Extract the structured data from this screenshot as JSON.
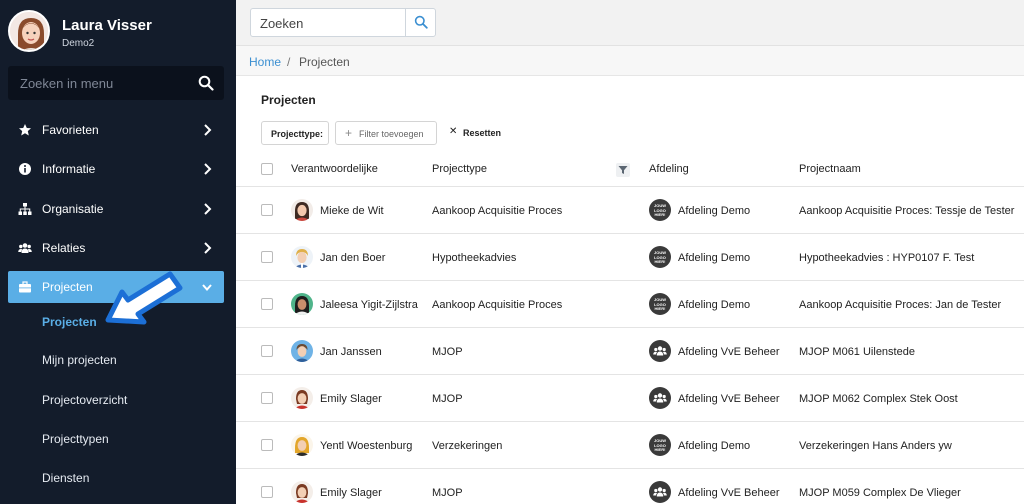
{
  "profile": {
    "name": "Laura Visser",
    "subtitle": "Demo2"
  },
  "menu_search": {
    "placeholder": "Zoeken in menu"
  },
  "menu": [
    {
      "label": "Favorieten",
      "icon": "star-icon"
    },
    {
      "label": "Informatie",
      "icon": "info-icon"
    },
    {
      "label": "Organisatie",
      "icon": "sitemap-icon"
    },
    {
      "label": "Relaties",
      "icon": "users-icon"
    },
    {
      "label": "Projecten",
      "icon": "briefcase-icon",
      "active": true
    }
  ],
  "submenu": [
    {
      "label": "Projecten",
      "active": true
    },
    {
      "label": "Mijn projecten"
    },
    {
      "label": "Projectoverzicht"
    },
    {
      "label": "Projecttypen"
    },
    {
      "label": "Diensten"
    }
  ],
  "top_search": {
    "placeholder": "Zoeken"
  },
  "breadcrumb": {
    "home": "Home",
    "separator": "/",
    "current": "Projecten"
  },
  "section_title": "Projecten",
  "filters": {
    "type_label": "Projecttype:",
    "add_label": "Filter toevoegen",
    "reset_label": "Resetten"
  },
  "table": {
    "headers": {
      "responsible": "Verantwoordelijke",
      "type": "Projecttype",
      "department": "Afdeling",
      "project": "Projectnaam"
    },
    "rows": [
      {
        "responsible": "Mieke de Wit",
        "type": "Aankoop Acquisitie Proces",
        "department": "Afdeling Demo",
        "dept_icon": "logo",
        "project": "Aankoop Acquisitie Proces: Tessje de Tester",
        "avatar": "female-dark-hair"
      },
      {
        "responsible": "Jan den Boer",
        "type": "Hypotheekadvies",
        "department": "Afdeling Demo",
        "dept_icon": "logo",
        "project": "Hypotheekadvies : HYP0107 F. Test",
        "avatar": "male-blond"
      },
      {
        "responsible": "Jaleesa Yigit-Zijlstra",
        "type": "Aankoop Acquisitie Proces",
        "department": "Afdeling Demo",
        "dept_icon": "logo",
        "project": "Aankoop Acquisitie Proces: Jan de Tester",
        "avatar": "female-green-bg"
      },
      {
        "responsible": "Jan Janssen",
        "type": "MJOP",
        "department": "Afdeling VvE Beheer",
        "dept_icon": "group",
        "project": "MJOP M061 Uilenstede",
        "avatar": "male-blue-bg"
      },
      {
        "responsible": "Emily Slager",
        "type": "MJOP",
        "department": "Afdeling VvE Beheer",
        "dept_icon": "group",
        "project": "MJOP M062 Complex Stek Oost",
        "avatar": "female-red-top"
      },
      {
        "responsible": "Yentl Woestenburg",
        "type": "Verzekeringen",
        "department": "Afdeling Demo",
        "dept_icon": "logo",
        "project": "Verzekeringen Hans Anders yw",
        "avatar": "female-blonde"
      },
      {
        "responsible": "Emily Slager",
        "type": "MJOP",
        "department": "Afdeling VvE Beheer",
        "dept_icon": "group",
        "project": "MJOP M059 Complex De Vlieger",
        "avatar": "female-red-top"
      }
    ]
  },
  "dept_logo_text": "JOUW LOGO HIER!",
  "colors": {
    "sidebar_bg": "#131c2b",
    "accent": "#5aaee6",
    "link": "#3b8fd1",
    "arrow": "#1c6fd6"
  }
}
